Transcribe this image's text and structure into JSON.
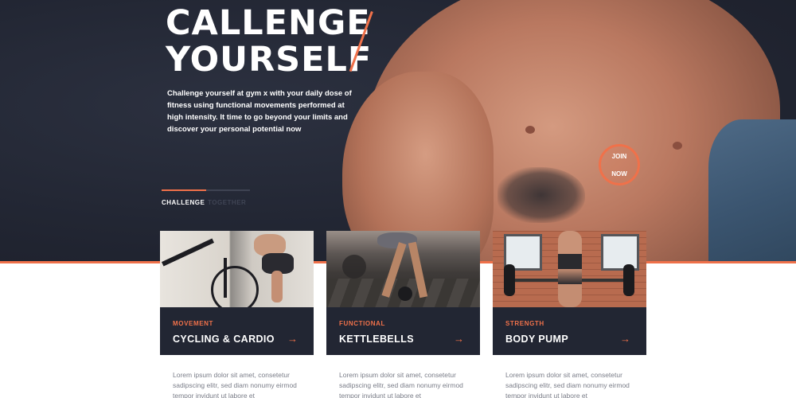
{
  "hero": {
    "title_line1": "CALLENGE",
    "title_line2": "YOURSELF",
    "description": "Challenge yourself at gym x with your daily dose of fitness using functional movements performed at high intensity. It time to go beyond your limits and discover your personal potential now",
    "join_line1": "JOIN",
    "join_line2": "NOW",
    "slider_progress": 0.5,
    "slides": [
      {
        "label": "CHALLENGE"
      },
      {
        "label": "TOGETHER"
      }
    ]
  },
  "cards": [
    {
      "category": "MOVEMENT",
      "title": "CYCLING & CARDIO",
      "text": "Lorem ipsum dolor sit amet, consetetur sadipscing elitr, sed diam nonumy eirmod tempor invidunt ut labore et"
    },
    {
      "category": "FUNCTIONAL",
      "title": "KETTLEBELLS",
      "text": "Lorem ipsum dolor sit amet, consetetur sadipscing elitr, sed diam nonumy eirmod tempor invidunt ut labore et"
    },
    {
      "category": "STRENGTH",
      "title": "BODY PUMP",
      "text": "Lorem ipsum dolor sit amet, consetetur sadipscing elitr, sed diam nonumy eirmod tempor invidunt ut labore et"
    }
  ],
  "icons": {
    "card_arrow": "arrow-right-icon"
  },
  "colors": {
    "accent": "#f0714a",
    "dark_bg": "#222633",
    "text_muted": "#7a7d88"
  }
}
